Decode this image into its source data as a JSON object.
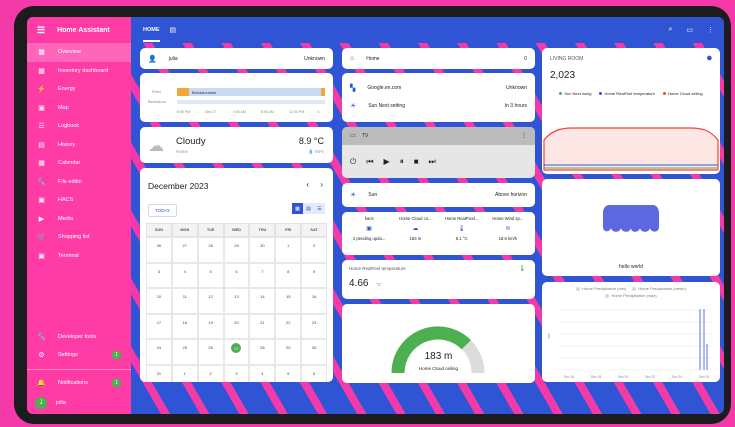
{
  "app": {
    "title": "Home Assistant"
  },
  "sidebar": {
    "items": [
      {
        "label": "Overview",
        "icon": "dashboard-icon",
        "glyph": "▦",
        "active": true
      },
      {
        "label": "Inventory dashboard",
        "icon": "dashboard-icon",
        "glyph": "▦"
      },
      {
        "label": "Energy",
        "icon": "lightning-icon",
        "glyph": "⚡"
      },
      {
        "label": "Map",
        "icon": "map-icon",
        "glyph": "▣"
      },
      {
        "label": "Logbook",
        "icon": "list-icon",
        "glyph": "☰"
      },
      {
        "label": "History",
        "icon": "chart-icon",
        "glyph": "▤"
      },
      {
        "label": "Calendar",
        "icon": "calendar-icon",
        "glyph": "▦"
      },
      {
        "label": "File editor",
        "icon": "wrench-icon",
        "glyph": "🔧"
      },
      {
        "label": "HACS",
        "icon": "hacs-icon",
        "glyph": "▣"
      },
      {
        "label": "Media",
        "icon": "media-icon",
        "glyph": "▶"
      },
      {
        "label": "Shopping list",
        "icon": "cart-icon",
        "glyph": "🛒"
      },
      {
        "label": "Terminal",
        "icon": "terminal-icon",
        "glyph": "▣"
      }
    ],
    "developer": "Developer tools",
    "settings": "Settings",
    "settings_badge": "1",
    "notifications": "Notifications",
    "notifications_badge": "1",
    "user": "jolla",
    "user_initial": "J"
  },
  "topbar": {
    "tab": "HOME"
  },
  "person_card": {
    "name": "julia",
    "state": "Unknown"
  },
  "history_card": {
    "label1": "Pixel",
    "segment": "Behaviourism",
    "label2": "Behaviour",
    "ticks": [
      "8:00 PM",
      "Dec 27",
      "4:00 AM",
      "8:00 AM",
      "12:00 PM",
      "4:"
    ]
  },
  "weather_card": {
    "condition": "Cloudy",
    "location": "Home",
    "temp": "8.9 °C",
    "humidity": "💧 95%"
  },
  "calendar_card": {
    "month": "December 2023",
    "today": "TODAY",
    "days": [
      "SUN",
      "MON",
      "TUE",
      "WED",
      "THU",
      "FRI",
      "SAT"
    ],
    "weeks": [
      [
        "26",
        "27",
        "28",
        "29",
        "30",
        "1",
        "2"
      ],
      [
        "3",
        "4",
        "5",
        "6",
        "7",
        "8",
        "9"
      ],
      [
        "10",
        "11",
        "12",
        "13",
        "14",
        "15",
        "16"
      ],
      [
        "17",
        "18",
        "19",
        "20",
        "21",
        "22",
        "23"
      ],
      [
        "24",
        "25",
        "26",
        "27",
        "28",
        "29",
        "30"
      ],
      [
        "31",
        "1",
        "2",
        "3",
        "4",
        "5",
        "6"
      ]
    ],
    "today_date": "27"
  },
  "home_card": {
    "label": "Home",
    "value": "0"
  },
  "google_card": {
    "label1": "Google.en.com",
    "value1": "Unknown",
    "label2": "Sun Next setting",
    "value2": "In 3 hours"
  },
  "tv_card": {
    "label": "TV"
  },
  "sun_card": {
    "label": "Sun",
    "value": "Above horizon"
  },
  "glance_card": {
    "headers": [
      "hacs",
      "Home Cloud co...",
      "Home RealPixel...",
      "Home Wind sp..."
    ],
    "values": [
      "2 pending upda...",
      "183 m",
      "5.1 °C",
      "18.5 km/h"
    ]
  },
  "sensor_card": {
    "label": "Home RealFeel temperature",
    "value": "4.66",
    "unit": "°C"
  },
  "gauge_card": {
    "value": "183 m",
    "label": "Home Cloud ceiling",
    "fraction": 0.75
  },
  "living_room_card": {
    "title": "LIVING ROOM",
    "value": "2,023",
    "legend": [
      "Sun Next rising",
      "Home RealFeel temperature",
      "Home Cloud ceiling"
    ],
    "colors": [
      "#4caf50",
      "#2f55d4",
      "#f44336"
    ]
  },
  "hello_card": {
    "label": "hello world"
  },
  "precip_card": {
    "legend": [
      "Home Precipitation (min)",
      "Home Precipitation (mean)",
      "Home Precipitation (max)"
    ],
    "x_ticks": [
      "Dec 16",
      "Dec 18",
      "Dec 20",
      "Dec 22",
      "Dec 24",
      "Dec 26"
    ],
    "y_label": "mm"
  }
}
